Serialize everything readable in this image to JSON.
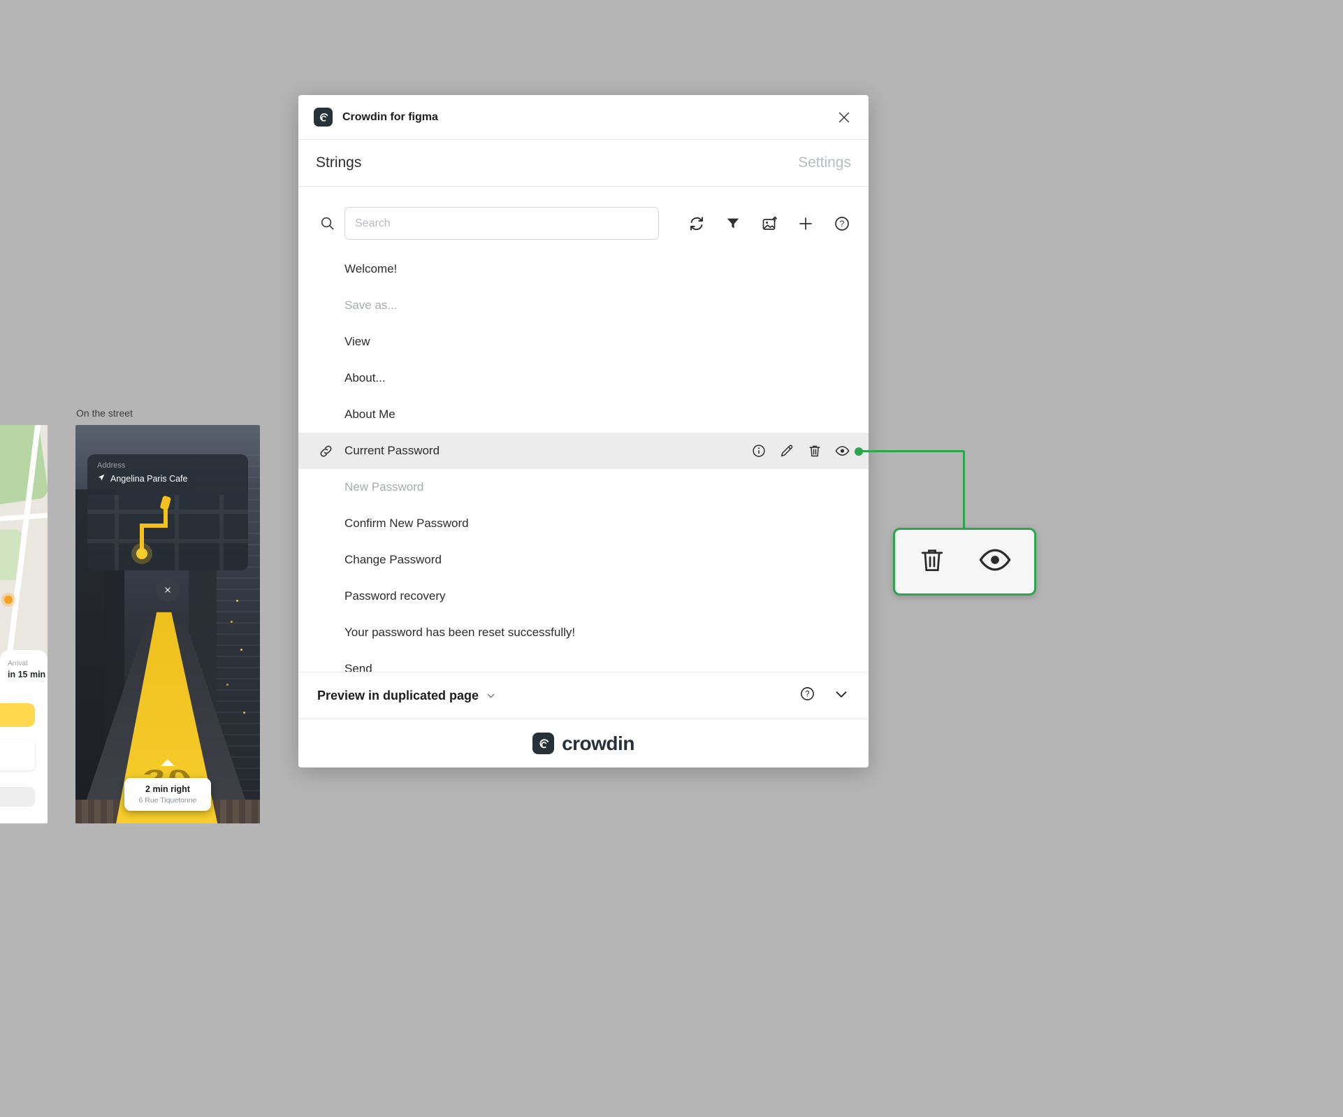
{
  "canvas": {
    "map_frame": {
      "arrival_label": "Arrival",
      "arrival_time": "in 15 min"
    },
    "street_frame": {
      "title": "On the street",
      "address_label": "Address",
      "address_value": "Angelina Paris Cafe",
      "ar_distance": "20",
      "direction_primary": "2 min right",
      "direction_secondary": "6 Rue Tiquetonne"
    }
  },
  "plugin": {
    "window_title": "Crowdin for figma",
    "tabs": {
      "strings": "Strings",
      "settings": "Settings"
    },
    "search": {
      "placeholder": "Search"
    },
    "strings": [
      {
        "label": "Welcome!"
      },
      {
        "label": "Save as...",
        "muted": true
      },
      {
        "label": "View"
      },
      {
        "label": "About..."
      },
      {
        "label": "About Me"
      },
      {
        "label": "Current Password",
        "selected": true
      },
      {
        "label": "New Password",
        "muted": true
      },
      {
        "label": "Confirm New Password"
      },
      {
        "label": "Change Password"
      },
      {
        "label": "Password recovery"
      },
      {
        "label": "Your password has been reset successfully!"
      },
      {
        "label": "Send",
        "partially_visible": true
      }
    ],
    "selected_row_icons": [
      "info-icon",
      "edit-icon",
      "delete-icon",
      "preview-icon"
    ],
    "preview_bar": {
      "label": "Preview in duplicated page"
    },
    "footer": {
      "wordmark": "crowdin"
    }
  },
  "callout": {
    "icons": [
      "delete-icon",
      "eye-icon"
    ]
  },
  "colors": {
    "canvas_bg": "#b5b5b5",
    "accent_green": "#2da44e",
    "selected_row_bg": "#ececec",
    "path_yellow": "#f0c11d",
    "logo_dark": "#263238"
  }
}
